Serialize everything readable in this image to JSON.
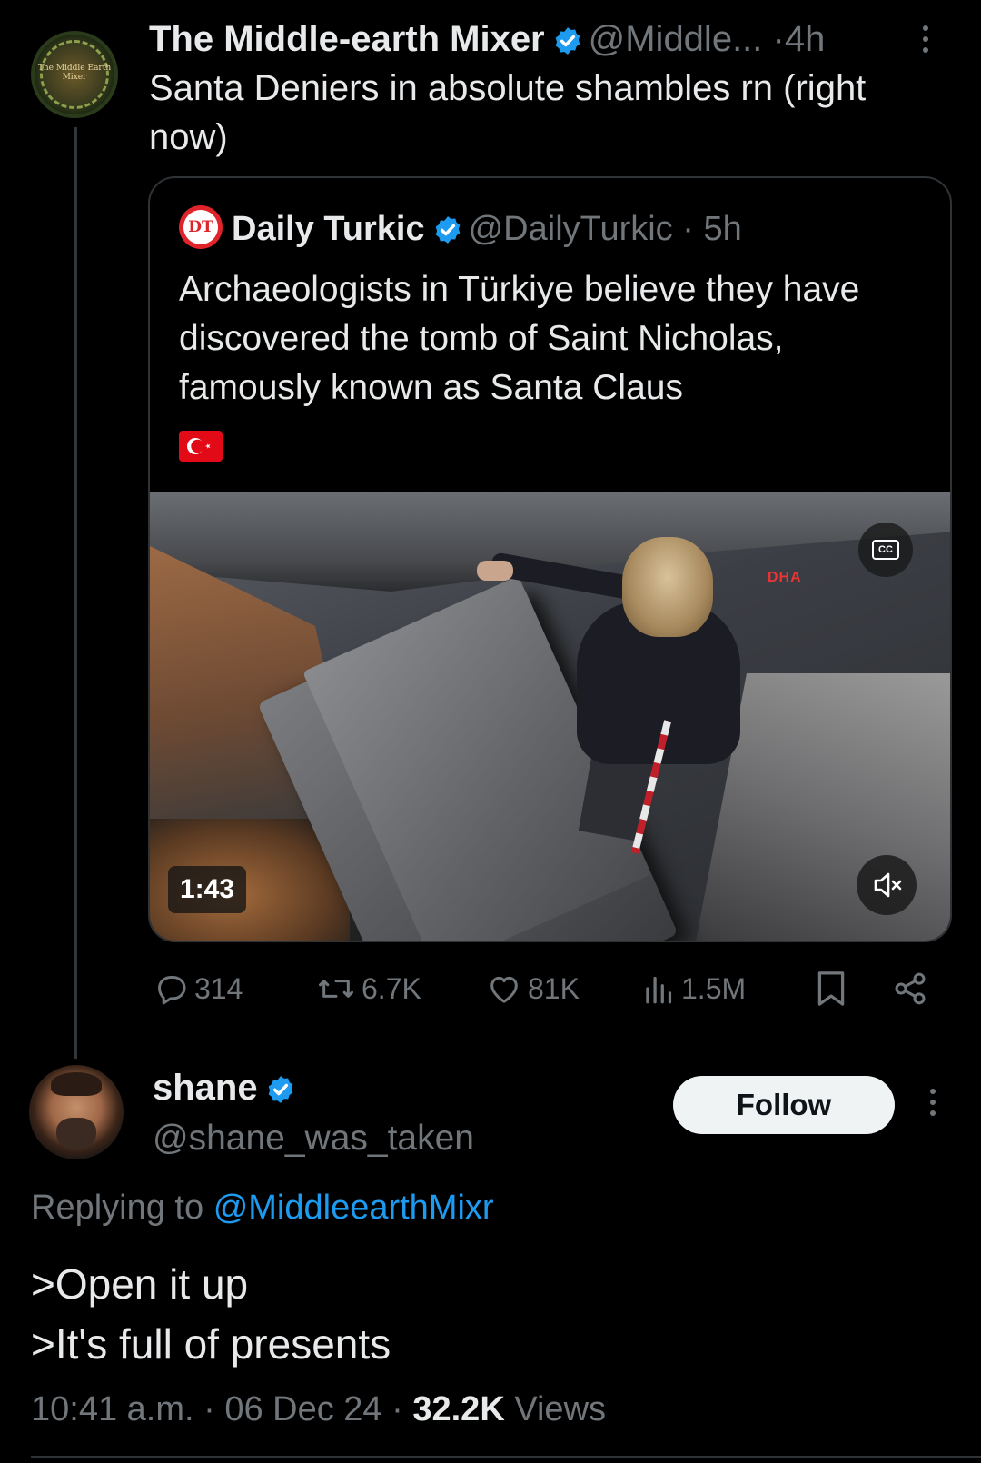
{
  "colors": {
    "background": "#000000",
    "text": "#e7e9ea",
    "muted": "#71767b",
    "accent": "#1d9bf0",
    "border": "#2f3336"
  },
  "tweet": {
    "author_name": "The Middle-earth Mixer",
    "avatar_text": "The Middle Earth Mixer",
    "handle": "@Middle...",
    "sep": "·",
    "time": "4h",
    "text": "Santa Deniers in absolute shambles rn (right now)",
    "more_icon": "more-vertical-icon"
  },
  "quote": {
    "logo_text": "DT",
    "author_name": "Daily Turkic",
    "handle": "@DailyTurkic",
    "sep": "·",
    "time": "5h",
    "text": "Archaeologists in Türkiye believe they have discovered the tomb of Saint Nicholas, famously known as Santa Claus",
    "flag_icon": "turkey-flag-icon",
    "video": {
      "duration": "1:43",
      "watermark": "DHA",
      "cc_label": "CC",
      "muted": true
    }
  },
  "actions": {
    "replies": "314",
    "reposts": "6.7K",
    "likes": "81K",
    "views": "1.5M"
  },
  "reply": {
    "author_name": "shane",
    "handle": "@shane_was_taken",
    "follow_label": "Follow",
    "replying_prefix": "Replying to",
    "replying_to": "@MiddleearthMixr",
    "line1": ">Open it up",
    "line2": ">It's full of presents",
    "time": "10:41 a.m.",
    "sep": "·",
    "date": "06 Dec 24",
    "views_count": "32.2K",
    "views_label": "Views"
  }
}
